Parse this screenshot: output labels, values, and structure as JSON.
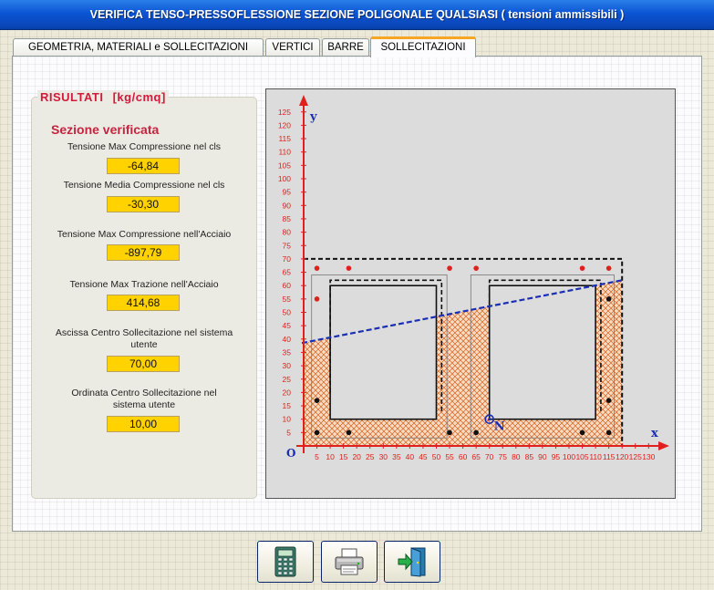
{
  "window": {
    "title": "VERIFICA TENSO-PRESSOFLESSIONE SEZIONE POLIGONALE QUALSIASI ( tensioni ammissibili )"
  },
  "tabs": [
    {
      "label": "GEOMETRIA, MATERIALI e SOLLECITAZIONI",
      "active": false
    },
    {
      "label": "VERTICI",
      "active": false
    },
    {
      "label": "BARRE",
      "active": false
    },
    {
      "label": "SOLLECITAZIONI",
      "active": true
    }
  ],
  "results": {
    "title": "RISULTATI [kg/cmq]",
    "status": "Sezione verificata",
    "items": [
      {
        "label": "Tensione Max Compressione nel cls",
        "value": "-64,84"
      },
      {
        "label": "Tensione Media Compressione nel cls",
        "value": "-30,30"
      },
      {
        "label": "Tensione Max Compressione nell'Acciaio",
        "value": "-897,79"
      },
      {
        "label": "Tensione Max Trazione nell'Acciaio",
        "value": "414,68"
      },
      {
        "label": "Ascissa Centro Sollecitazione nel sistema utente",
        "value": "70,00"
      },
      {
        "label": "Ordinata Centro Sollecitazione nel sistema utente",
        "value": "10,00"
      }
    ]
  },
  "plot": {
    "axis_x_label": "x",
    "axis_y_label": "y",
    "origin_label": "O",
    "load_point_label": "N",
    "x_ticks": [
      5,
      10,
      15,
      20,
      25,
      30,
      35,
      40,
      45,
      50,
      55,
      60,
      65,
      70,
      75,
      80,
      85,
      90,
      95,
      100,
      105,
      110,
      115,
      120,
      125,
      130
    ],
    "y_ticks": [
      5,
      10,
      15,
      20,
      25,
      30,
      35,
      40,
      45,
      50,
      55,
      60,
      65,
      70,
      75,
      80,
      85,
      90,
      95,
      100,
      105,
      110,
      115,
      120,
      125
    ],
    "section_outer": {
      "x0": 0,
      "x1": 120,
      "y0": 0,
      "y1": 70
    },
    "voids": [
      {
        "x0": 10,
        "x1": 50,
        "y0": 10,
        "y1": 60
      },
      {
        "x0": 70,
        "x1": 110,
        "y0": 10,
        "y1": 60
      }
    ],
    "neutral_axis": [
      [
        0,
        38.5
      ],
      [
        120,
        62
      ]
    ],
    "load_point": {
      "x": 70,
      "y": 10
    },
    "bars_compressed": [
      [
        5,
        66.5
      ],
      [
        17,
        66.5
      ],
      [
        55,
        66.5
      ],
      [
        65,
        66.5
      ],
      [
        105,
        66.5
      ],
      [
        115,
        66.5
      ],
      [
        5,
        55
      ]
    ],
    "bars_tensioned": [
      [
        5,
        5
      ],
      [
        17,
        5
      ],
      [
        55,
        5
      ],
      [
        65,
        5
      ],
      [
        105,
        5
      ],
      [
        115,
        5
      ],
      [
        5,
        17
      ],
      [
        115,
        17
      ],
      [
        115,
        55
      ]
    ],
    "colors": {
      "axes": "#e0201c",
      "tick_labels": "#e0201c",
      "neutral_axis": "#1a2fb4",
      "hatch": "#d8601f",
      "compressed_fill": "#f7dcc2",
      "axis_labels": "#1a2fb4"
    }
  },
  "buttons": [
    {
      "name": "calculate",
      "icon": "calculator-icon"
    },
    {
      "name": "print",
      "icon": "printer-icon"
    },
    {
      "name": "exit",
      "icon": "exit-door-icon"
    }
  ]
}
